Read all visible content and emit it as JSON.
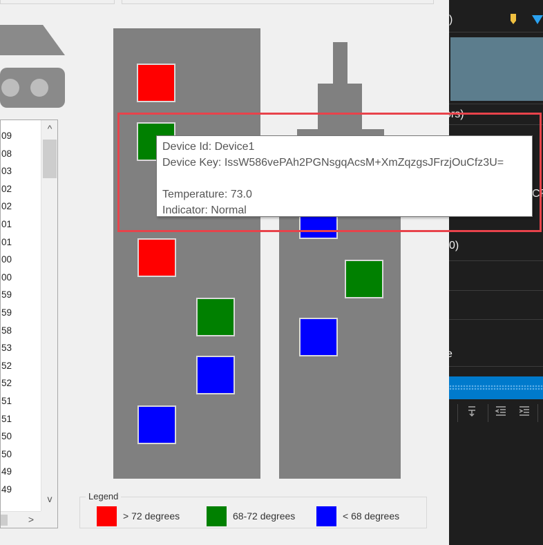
{
  "top_icons": {
    "flag_color": "#f0c040",
    "triangle_color": "#2aa1f0"
  },
  "device_list": {
    "items": [
      "09",
      "08",
      "03",
      "02",
      "02",
      "01",
      "01",
      "00",
      "00",
      "59",
      "59",
      "58",
      "53",
      "52",
      "52",
      "51",
      "51",
      "50",
      "50",
      "49",
      "49"
    ],
    "scroll_up": "^",
    "scroll_down": "v",
    "scroll_right": ">"
  },
  "legend": {
    "title": "Legend",
    "items": [
      {
        "label": "> 72 degrees",
        "color": "#ff0000"
      },
      {
        "label": "68-72 degrees",
        "color": "#008000"
      },
      {
        "label": "< 68 degrees",
        "color": "#0000ff"
      }
    ]
  },
  "tooltip": {
    "device_id": "Device Id: Device1",
    "device_key": "Device Key: IssW586vePAh2PGNsgqAcsM+XmZqzgsJFrzjOuCfz3U=",
    "temperature": "Temperature: 73.0",
    "indicator": "Indicator: Normal"
  },
  "right_panel": {
    "text_paren": ")",
    "text_ors": "ors)",
    "text_cr": "CR",
    "text_zero": "0)",
    "text_e": "e"
  },
  "colors": {
    "hot": "#ff0000",
    "normal": "#008000",
    "cold": "#0000ff",
    "building": "#808080",
    "highlight": "#e8434b",
    "dark_panel": "#1e1e1e",
    "accent_blue": "#007acc"
  }
}
